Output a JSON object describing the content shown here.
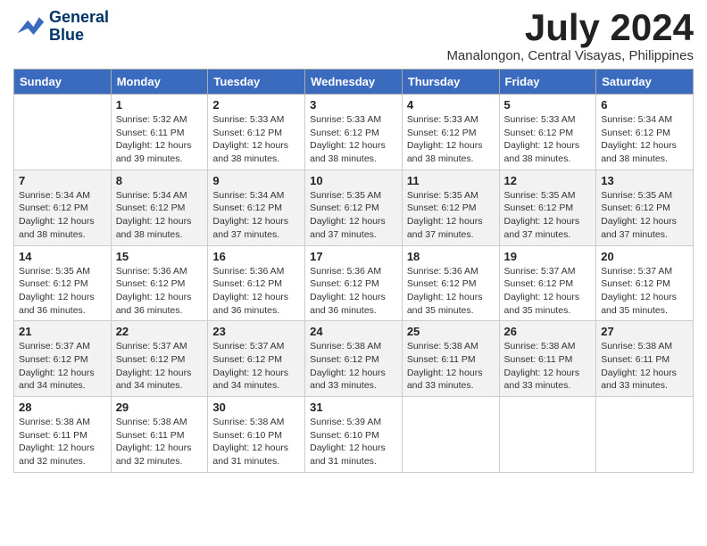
{
  "header": {
    "logo_line1": "General",
    "logo_line2": "Blue",
    "month_title": "July 2024",
    "subtitle": "Manalongon, Central Visayas, Philippines"
  },
  "weekdays": [
    "Sunday",
    "Monday",
    "Tuesday",
    "Wednesday",
    "Thursday",
    "Friday",
    "Saturday"
  ],
  "weeks": [
    [
      {
        "day": "",
        "sunrise": "",
        "sunset": "",
        "daylight": "",
        "empty": true
      },
      {
        "day": "1",
        "sunrise": "Sunrise: 5:32 AM",
        "sunset": "Sunset: 6:11 PM",
        "daylight": "Daylight: 12 hours and 39 minutes."
      },
      {
        "day": "2",
        "sunrise": "Sunrise: 5:33 AM",
        "sunset": "Sunset: 6:12 PM",
        "daylight": "Daylight: 12 hours and 38 minutes."
      },
      {
        "day": "3",
        "sunrise": "Sunrise: 5:33 AM",
        "sunset": "Sunset: 6:12 PM",
        "daylight": "Daylight: 12 hours and 38 minutes."
      },
      {
        "day": "4",
        "sunrise": "Sunrise: 5:33 AM",
        "sunset": "Sunset: 6:12 PM",
        "daylight": "Daylight: 12 hours and 38 minutes."
      },
      {
        "day": "5",
        "sunrise": "Sunrise: 5:33 AM",
        "sunset": "Sunset: 6:12 PM",
        "daylight": "Daylight: 12 hours and 38 minutes."
      },
      {
        "day": "6",
        "sunrise": "Sunrise: 5:34 AM",
        "sunset": "Sunset: 6:12 PM",
        "daylight": "Daylight: 12 hours and 38 minutes."
      }
    ],
    [
      {
        "day": "7",
        "sunrise": "Sunrise: 5:34 AM",
        "sunset": "Sunset: 6:12 PM",
        "daylight": "Daylight: 12 hours and 38 minutes."
      },
      {
        "day": "8",
        "sunrise": "Sunrise: 5:34 AM",
        "sunset": "Sunset: 6:12 PM",
        "daylight": "Daylight: 12 hours and 38 minutes."
      },
      {
        "day": "9",
        "sunrise": "Sunrise: 5:34 AM",
        "sunset": "Sunset: 6:12 PM",
        "daylight": "Daylight: 12 hours and 37 minutes."
      },
      {
        "day": "10",
        "sunrise": "Sunrise: 5:35 AM",
        "sunset": "Sunset: 6:12 PM",
        "daylight": "Daylight: 12 hours and 37 minutes."
      },
      {
        "day": "11",
        "sunrise": "Sunrise: 5:35 AM",
        "sunset": "Sunset: 6:12 PM",
        "daylight": "Daylight: 12 hours and 37 minutes."
      },
      {
        "day": "12",
        "sunrise": "Sunrise: 5:35 AM",
        "sunset": "Sunset: 6:12 PM",
        "daylight": "Daylight: 12 hours and 37 minutes."
      },
      {
        "day": "13",
        "sunrise": "Sunrise: 5:35 AM",
        "sunset": "Sunset: 6:12 PM",
        "daylight": "Daylight: 12 hours and 37 minutes."
      }
    ],
    [
      {
        "day": "14",
        "sunrise": "Sunrise: 5:35 AM",
        "sunset": "Sunset: 6:12 PM",
        "daylight": "Daylight: 12 hours and 36 minutes."
      },
      {
        "day": "15",
        "sunrise": "Sunrise: 5:36 AM",
        "sunset": "Sunset: 6:12 PM",
        "daylight": "Daylight: 12 hours and 36 minutes."
      },
      {
        "day": "16",
        "sunrise": "Sunrise: 5:36 AM",
        "sunset": "Sunset: 6:12 PM",
        "daylight": "Daylight: 12 hours and 36 minutes."
      },
      {
        "day": "17",
        "sunrise": "Sunrise: 5:36 AM",
        "sunset": "Sunset: 6:12 PM",
        "daylight": "Daylight: 12 hours and 36 minutes."
      },
      {
        "day": "18",
        "sunrise": "Sunrise: 5:36 AM",
        "sunset": "Sunset: 6:12 PM",
        "daylight": "Daylight: 12 hours and 35 minutes."
      },
      {
        "day": "19",
        "sunrise": "Sunrise: 5:37 AM",
        "sunset": "Sunset: 6:12 PM",
        "daylight": "Daylight: 12 hours and 35 minutes."
      },
      {
        "day": "20",
        "sunrise": "Sunrise: 5:37 AM",
        "sunset": "Sunset: 6:12 PM",
        "daylight": "Daylight: 12 hours and 35 minutes."
      }
    ],
    [
      {
        "day": "21",
        "sunrise": "Sunrise: 5:37 AM",
        "sunset": "Sunset: 6:12 PM",
        "daylight": "Daylight: 12 hours and 34 minutes."
      },
      {
        "day": "22",
        "sunrise": "Sunrise: 5:37 AM",
        "sunset": "Sunset: 6:12 PM",
        "daylight": "Daylight: 12 hours and 34 minutes."
      },
      {
        "day": "23",
        "sunrise": "Sunrise: 5:37 AM",
        "sunset": "Sunset: 6:12 PM",
        "daylight": "Daylight: 12 hours and 34 minutes."
      },
      {
        "day": "24",
        "sunrise": "Sunrise: 5:38 AM",
        "sunset": "Sunset: 6:12 PM",
        "daylight": "Daylight: 12 hours and 33 minutes."
      },
      {
        "day": "25",
        "sunrise": "Sunrise: 5:38 AM",
        "sunset": "Sunset: 6:11 PM",
        "daylight": "Daylight: 12 hours and 33 minutes."
      },
      {
        "day": "26",
        "sunrise": "Sunrise: 5:38 AM",
        "sunset": "Sunset: 6:11 PM",
        "daylight": "Daylight: 12 hours and 33 minutes."
      },
      {
        "day": "27",
        "sunrise": "Sunrise: 5:38 AM",
        "sunset": "Sunset: 6:11 PM",
        "daylight": "Daylight: 12 hours and 33 minutes."
      }
    ],
    [
      {
        "day": "28",
        "sunrise": "Sunrise: 5:38 AM",
        "sunset": "Sunset: 6:11 PM",
        "daylight": "Daylight: 12 hours and 32 minutes."
      },
      {
        "day": "29",
        "sunrise": "Sunrise: 5:38 AM",
        "sunset": "Sunset: 6:11 PM",
        "daylight": "Daylight: 12 hours and 32 minutes."
      },
      {
        "day": "30",
        "sunrise": "Sunrise: 5:38 AM",
        "sunset": "Sunset: 6:10 PM",
        "daylight": "Daylight: 12 hours and 31 minutes."
      },
      {
        "day": "31",
        "sunrise": "Sunrise: 5:39 AM",
        "sunset": "Sunset: 6:10 PM",
        "daylight": "Daylight: 12 hours and 31 minutes."
      },
      {
        "day": "",
        "sunrise": "",
        "sunset": "",
        "daylight": "",
        "empty": true
      },
      {
        "day": "",
        "sunrise": "",
        "sunset": "",
        "daylight": "",
        "empty": true
      },
      {
        "day": "",
        "sunrise": "",
        "sunset": "",
        "daylight": "",
        "empty": true
      }
    ]
  ]
}
